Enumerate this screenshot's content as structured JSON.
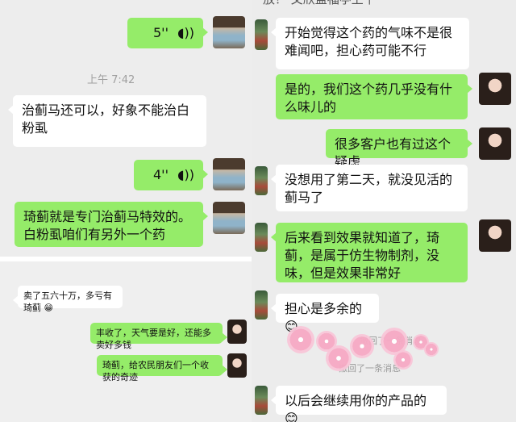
{
  "left": {
    "voice1": {
      "duration": "5''"
    },
    "timestamp": "上午 7:42",
    "msg_received_1": "治蓟马还可以，好象不能治白粉虱",
    "voice2": {
      "duration": "4''"
    },
    "msg_sent_1": "琦蓟就是专门治蓟马特效的。白粉虱咱们有另外一个药"
  },
  "inset": {
    "msg_received": "卖了五六十万，多亏有琦蓟",
    "msg_received_emoji": "😁",
    "msg_sent_1": "丰收了，天气要是好，还能多卖好多钱",
    "msg_sent_2": "琦蓟，给农民朋友们一个收获的奇迹"
  },
  "right": {
    "top_cut": "放？ 文欣盖福亭上午",
    "msg_r1": "开始觉得这个药的气味不是很难闻吧，担心药可能不行",
    "msg_s1": "是的，我们这个药几乎没有什么味儿的",
    "msg_s2": "很多客户也有过这个疑虑",
    "msg_r2": "没想用了第二天，就没见活的蓟马了",
    "msg_r3": "后来看到效果就知道了，琦蓟，是属于仿生物制剂，没味，但是效果非常好",
    "msg_r4": "担心是多余的",
    "msg_r4_emoji": "😊",
    "recall_1": "撤回了一条消息",
    "recall_2": "撤回了一条消息",
    "msg_r5": "以后会继续用你的产品的",
    "msg_r5_emoji": "😊"
  },
  "icons": {
    "voice": "voice-wave-icon"
  },
  "colors": {
    "chat_bg": "#ededed",
    "sent_bubble": "#95ec69",
    "received_bubble": "#ffffff"
  }
}
